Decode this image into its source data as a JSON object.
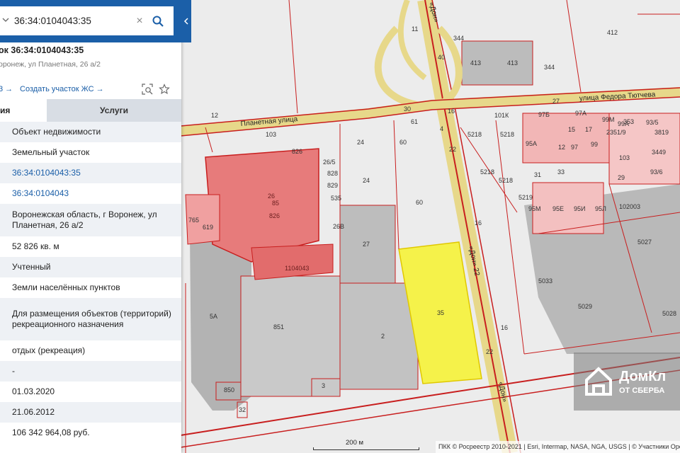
{
  "search": {
    "value": "36:34:0104043:35",
    "clear_glyph": "×"
  },
  "icons": {
    "chevron": "chevron-down-icon",
    "search": "search-icon",
    "clear": "close-icon",
    "collapse": "chevron-left-icon",
    "zoom_parcel": "zoom-to-object-icon",
    "favorite": "star-icon",
    "logo": "house-logo-icon"
  },
  "colors": {
    "brand": "#1b5fa8",
    "selected_parcel": "#f5f24a",
    "parcel_red": "#e04848",
    "boundary": "#c81e1e"
  },
  "parcel": {
    "title": "ок 36:34:0104043:35",
    "address": "оронеж, ул Планетная, 26 а/2"
  },
  "actions": {
    "prev_link": "3 →",
    "create_parcel": "Создать участок ЖС →"
  },
  "tabs": {
    "info": "ия",
    "services": "Услуги"
  },
  "attributes": [
    "Объект недвижимости",
    "Земельный участок",
    "36:34:0104043:35",
    "36:34:0104043",
    "Воронежская область, г Воронеж, ул Планетная, 26 а/2",
    "52 826 кв. м",
    "Учтенный",
    "Земли населённых пунктов",
    "Для размещения объектов (территорий) рекреационного назначения",
    "отдых (рекреация)",
    "-",
    "01.03.2020",
    "21.06.2012",
    "106 342 964,08 руб."
  ],
  "map": {
    "streets": {
      "planetnaya": "Планетная улица",
      "tyutcheva": "улица Федора Тютчева",
      "don_top": "«Дон»",
      "don_mid": "«Дон» 22",
      "don_bottom": "«Дон»"
    },
    "labels": {
      "l11": "11",
      "l344a": "344",
      "l412": "412",
      "l413a": "413",
      "l413b": "413",
      "l344b": "344",
      "l40": "40",
      "l12": "12",
      "l30": "30",
      "l61": "61",
      "l16a": "16",
      "l4": "4",
      "l27": "27",
      "l101k": "101К",
      "l97b": "97Б",
      "l97a": "97А",
      "l103a": "103",
      "l826a": "826",
      "l24a": "24",
      "l60a": "60",
      "l22a": "22",
      "l5218a": "5218",
      "l5218b": "5218",
      "l5218c": "5218",
      "l5218d": "5218",
      "l26v": "26/5",
      "l828": "828",
      "l829": "829",
      "l535": "535",
      "l26": "26",
      "l85": "85",
      "l826b": "826",
      "l24b": "24",
      "l60b": "60",
      "l26b": "26В",
      "l27b": "27",
      "l765": "765",
      "l619": "619",
      "l104043": "1104043",
      "l5a": "5А",
      "l851": "851",
      "l2": "2",
      "l35": "35",
      "l22b": "22",
      "l16b": "16",
      "l16c": "16",
      "l850": "850",
      "l3": "3",
      "l32": "32",
      "l95a": "95А",
      "l12b": "12",
      "l97": "97",
      "l99": "99",
      "l15": "15",
      "l17": "17",
      "l31": "31",
      "l33": "33",
      "l5219": "5219",
      "l95m": "95М",
      "l95e": "95Е",
      "l95i": "95И",
      "l95l": "95Л",
      "l102003": "102003",
      "l5027": "5027",
      "l5033": "5033",
      "l5029": "5029",
      "l5028": "5028",
      "l99m": "99М",
      "l99a": "99А",
      "l353": "353",
      "l935": "93/5",
      "l3819": "3819",
      "l3449": "3449",
      "l936": "93/6",
      "l103b": "103",
      "l29": "29",
      "l23519": "2351/9"
    }
  },
  "scale": {
    "label": "200 м"
  },
  "attribution": "ПКК © Росреестр 2010-2021 | Esri, Intermap, NASA, NGA, USGS | © Участники Open",
  "watermark": {
    "name": "ДомКл",
    "sub": "ОТ СБЕРБА"
  }
}
